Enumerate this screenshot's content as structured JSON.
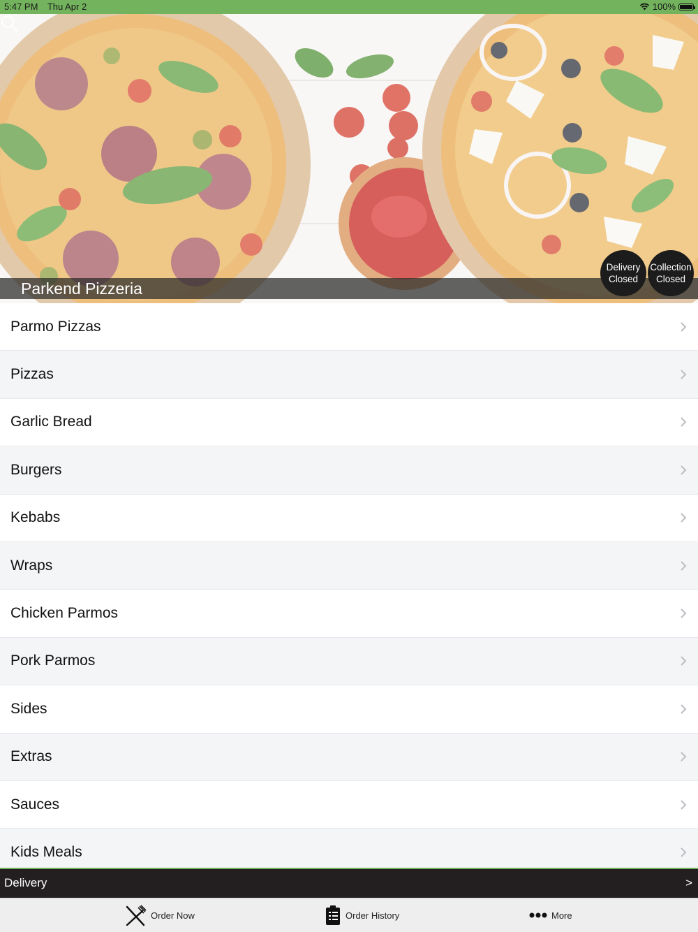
{
  "status_bar": {
    "time": "5:47 PM",
    "date": "Thu Apr 2",
    "battery": "100%",
    "icons": [
      "wifi-icon",
      "battery-icon"
    ]
  },
  "hero": {
    "restaurant_name": "Parkend Pizzeria",
    "delivery_status": {
      "line1": "Delivery",
      "line2": "Closed"
    },
    "collection_status": {
      "line1": "Collection",
      "line2": "Closed"
    },
    "search_icon": "search-icon"
  },
  "menu": {
    "items": [
      {
        "label": "Parmo Pizzas"
      },
      {
        "label": "Pizzas"
      },
      {
        "label": "Garlic Bread"
      },
      {
        "label": "Burgers"
      },
      {
        "label": "Kebabs"
      },
      {
        "label": "Wraps"
      },
      {
        "label": "Chicken Parmos"
      },
      {
        "label": "Pork Parmos"
      },
      {
        "label": "Sides"
      },
      {
        "label": "Extras"
      },
      {
        "label": "Sauces"
      },
      {
        "label": "Kids Meals"
      }
    ]
  },
  "delivery_bar": {
    "label": "Delivery",
    "arrow": ">"
  },
  "tab_bar": {
    "tabs": [
      {
        "label": "Order Now",
        "icon": "fork-knife-icon"
      },
      {
        "label": "Order History",
        "icon": "clipboard-icon"
      },
      {
        "label": "More",
        "icon": "more-dots-icon"
      }
    ]
  },
  "colors": {
    "accent_green": "#73b35d",
    "dark_bar": "#231f20",
    "status_pill": "#1c1c1c"
  }
}
